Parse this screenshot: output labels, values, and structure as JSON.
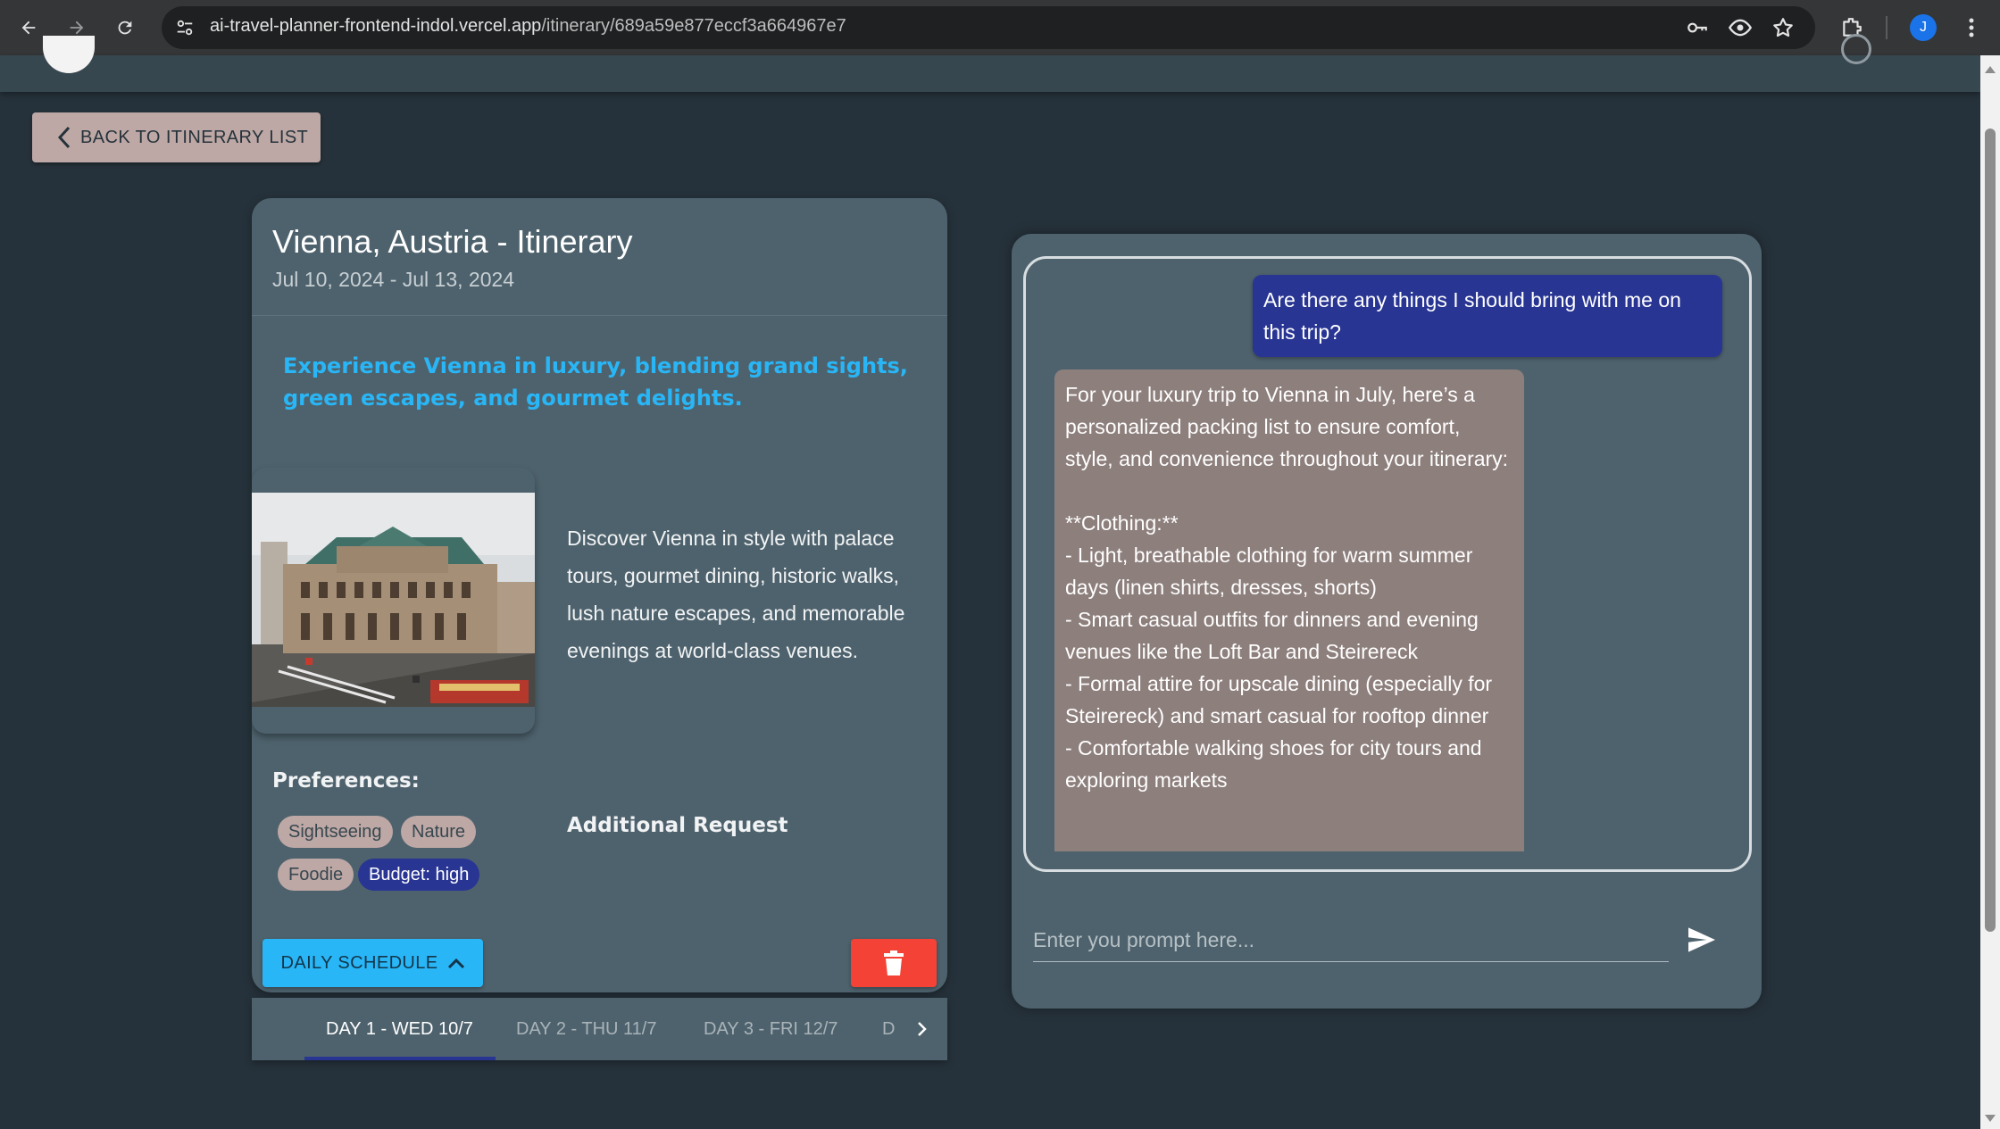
{
  "browser": {
    "url_host": "ai-travel-planner-frontend-indol.vercel.app",
    "url_path": "/itinerary/689a59e877eccf3a664967e7",
    "profile_initial": "J"
  },
  "back_button": {
    "label": "BACK TO ITINERARY LIST"
  },
  "itinerary": {
    "title": "Vienna, Austria - Itinerary",
    "dates": "Jul 10, 2024 - Jul 13, 2024",
    "tagline": "Experience Vienna in luxury, blending grand sights, green escapes, and gourmet delights.",
    "description": "Discover Vienna in style with palace tours, gourmet dining, historic walks, lush nature escapes, and memorable evenings at world-class venues.",
    "preferences_label": "Preferences:",
    "preferences": [
      "Sightseeing",
      "Nature",
      "Foodie",
      "Budget: high"
    ],
    "additional_request_label": "Additional Request",
    "daily_schedule_label": "DAILY SCHEDULE"
  },
  "day_tabs": [
    "DAY 1 - WED 10/7",
    "DAY 2 - THU 11/7",
    "DAY 3 - FRI 12/7",
    "D"
  ],
  "chat": {
    "user_message": "Are there any things I should bring with me on this trip?",
    "bot_message": "For your luxury trip to Vienna in July, here’s a personalized packing list to ensure comfort, style, and convenience throughout your itinerary:\n\n**Clothing:**\n- Light, breathable clothing for warm summer days (linen shirts, dresses, shorts)\n- Smart casual outfits for dinners and evening venues like the Loft Bar and Steirereck\n- Formal attire for upscale dining (especially for Steirereck) and smart casual for rooftop dinner\n- Comfortable walking shoes for city tours and exploring markets",
    "prompt_placeholder": "Enter you prompt here..."
  },
  "colors": {
    "background": "#26323b",
    "card": "#4e626d",
    "accent_blue": "#29b6f6",
    "chip": "#bda8a5",
    "chip_dark": "#283593",
    "delete": "#f44336",
    "bot_bubble": "#8d7f7c"
  },
  "icons": [
    "back-arrow-icon",
    "forward-arrow-icon",
    "reload-icon",
    "site-settings-icon",
    "key-icon",
    "eye-icon",
    "star-icon",
    "extensions-icon",
    "more-icon",
    "chevron-left-icon",
    "chevron-up-icon",
    "trash-icon",
    "chevron-right-icon",
    "send-icon"
  ]
}
